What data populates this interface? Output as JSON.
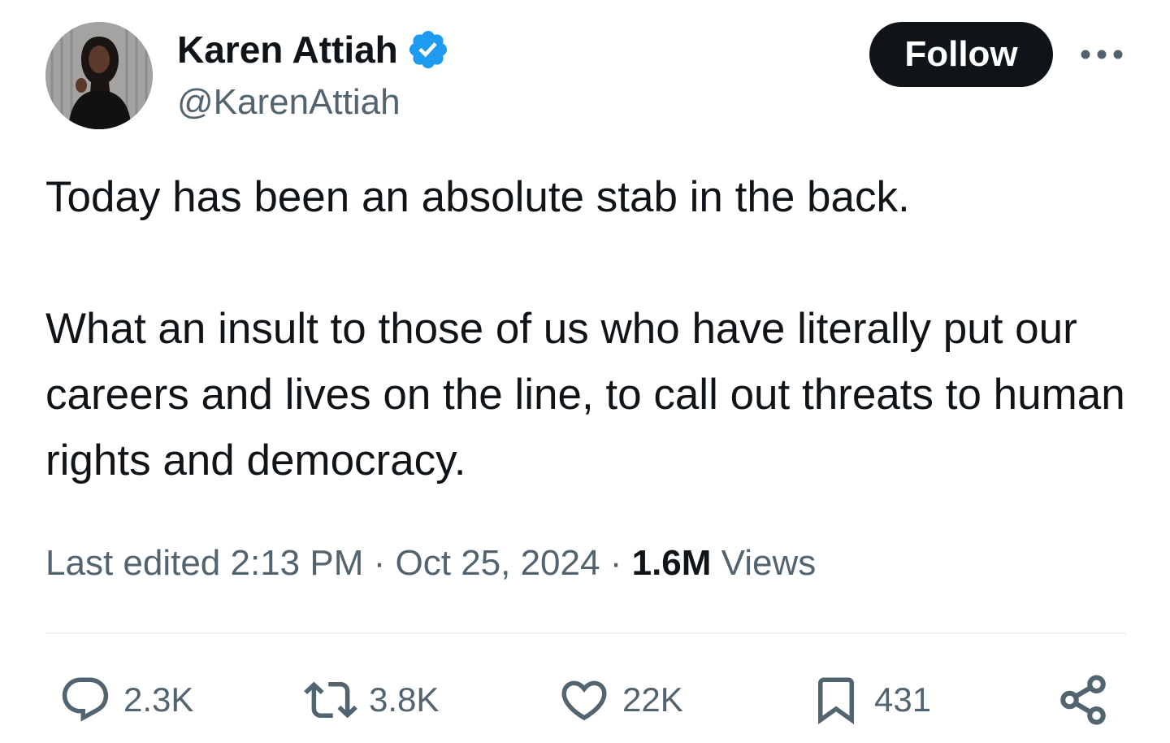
{
  "author": {
    "display_name": "Karen Attiah",
    "handle": "@KarenAttiah",
    "verified": true,
    "verified_color": "#1d9bf0"
  },
  "follow_button": {
    "label": "Follow"
  },
  "more_menu": {
    "icon": "more-horizontal-icon"
  },
  "tweet": {
    "paragraphs": [
      "Today has been an absolute stab in the back.",
      "What an insult to those of us who have literally put our careers and lives on the line, to call out threats to human rights and democracy."
    ]
  },
  "meta": {
    "edited_label": "Last edited",
    "time": "2:13 PM",
    "separator": "·",
    "date": "Oct 25, 2024",
    "views_count": "1.6M",
    "views_label": "Views"
  },
  "actions": {
    "reply": {
      "icon": "reply-icon",
      "count": "2.3K"
    },
    "repost": {
      "icon": "repost-icon",
      "count": "3.8K"
    },
    "like": {
      "icon": "heart-icon",
      "count": "22K"
    },
    "bookmark": {
      "icon": "bookmark-icon",
      "count": "431"
    },
    "share": {
      "icon": "share-icon"
    }
  },
  "colors": {
    "text_primary": "#0f1419",
    "text_secondary": "#536471",
    "divider": "#eff3f4",
    "button_bg": "#0f1419"
  }
}
